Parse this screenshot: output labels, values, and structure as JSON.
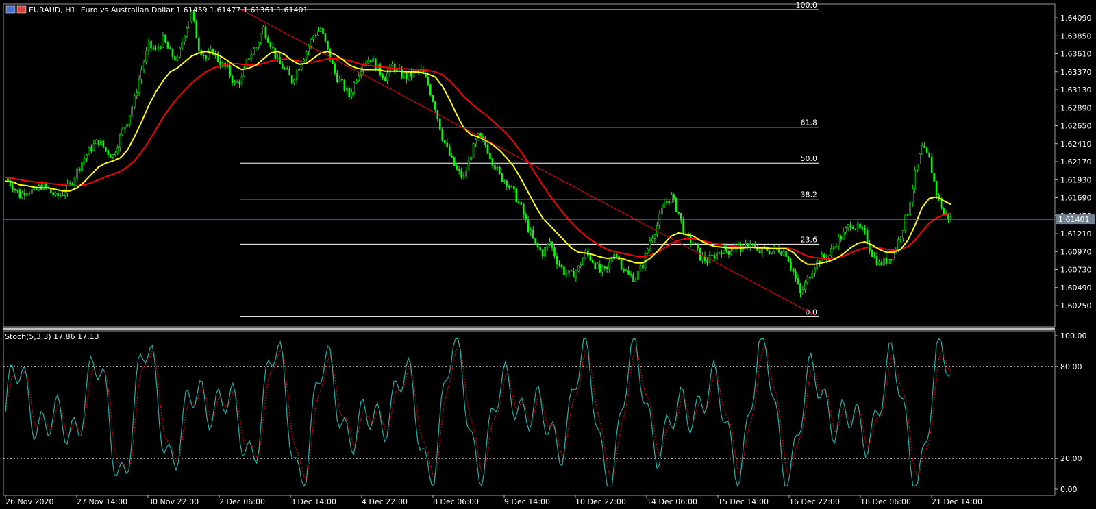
{
  "main_chart": {
    "symbol": "EURAUD",
    "timeframe": "H1",
    "description": "Euro vs Australian Dollar",
    "ohlc": "1.61459 1.61477 1.61361 1.61401",
    "title": "EURAUD, H1:  Euro vs Australian Dollar  1.61459 1.61477 1.61361 1.61401",
    "price_ticks": [
      "1.64090",
      "1.63850",
      "1.63610",
      "1.63370",
      "1.63130",
      "1.62890",
      "1.62650",
      "1.62410",
      "1.62170",
      "1.61930",
      "1.61690",
      "1.61450",
      "1.61210",
      "1.60970",
      "1.60730",
      "1.60490",
      "1.60250"
    ],
    "current_price": "1.61401",
    "fib_levels": [
      {
        "label": "100.0",
        "value": 1.642
      },
      {
        "label": "61.8",
        "value": 1.6263
      },
      {
        "label": "50.0",
        "value": 1.6215
      },
      {
        "label": "38.2",
        "value": 1.6167
      },
      {
        "label": "23.6",
        "value": 1.6107
      },
      {
        "label": "0.0",
        "value": 1.601
      }
    ]
  },
  "stoch_panel": {
    "title": "Stoch(5,3,3) 17.86 17.13",
    "ticks": [
      "100.00",
      "80.00",
      "20.00",
      "0.00"
    ]
  },
  "time_axis": {
    "labels": [
      "26 Nov 2020",
      "27 Nov 14:00",
      "30 Nov 22:00",
      "2 Dec 06:00",
      "3 Dec 14:00",
      "4 Dec 22:00",
      "8 Dec 06:00",
      "9 Dec 14:00",
      "10 Dec 22:00",
      "14 Dec 06:00",
      "15 Dec 14:00",
      "16 Dec 22:00",
      "18 Dec 06:00",
      "21 Dec 14:00"
    ]
  },
  "colors": {
    "background": "#000000",
    "candles": "#00ff00",
    "ma_fast": "#ffff00",
    "ma_slow": "#ff0000",
    "trendline": "#ff0000",
    "fib": "#ffffff",
    "stoch_main": "#20b2aa",
    "stoch_signal": "#ff0000",
    "price_line": "#708090"
  },
  "chart_data": {
    "type": "line",
    "title": "EURAUD, H1:  Euro vs Australian Dollar  1.61459 1.61477 1.61361 1.61401",
    "ylim": [
      1.601,
      1.643
    ],
    "series": [
      {
        "values": [
          1.6195,
          1.6185,
          1.6172,
          1.618,
          1.6176,
          1.6185,
          1.618,
          1.617,
          1.6175,
          1.6185,
          1.6205,
          1.6222,
          1.6236,
          1.6245,
          1.6232,
          1.6225,
          1.625,
          1.6272,
          1.63,
          1.634,
          1.6372,
          1.6365,
          1.638,
          1.6362,
          1.6352,
          1.639,
          1.6415,
          1.637,
          1.6355,
          1.6365,
          1.6348,
          1.634,
          1.632,
          1.6328,
          1.6358,
          1.637,
          1.6395,
          1.6375,
          1.635,
          1.634,
          1.6325,
          1.6345,
          1.6365,
          1.6385,
          1.6395,
          1.6365,
          1.6335,
          1.632,
          1.6305,
          1.633,
          1.635,
          1.6355,
          1.634,
          1.633,
          1.6345,
          1.6335,
          1.633,
          1.6335,
          1.6338,
          1.632,
          1.629,
          1.625,
          1.6225,
          1.6205,
          1.6195,
          1.6228,
          1.625,
          1.624,
          1.6218,
          1.6198,
          1.619,
          1.6175,
          1.6155,
          1.6128,
          1.6105,
          1.6095,
          1.611,
          1.6085,
          1.607,
          1.6065,
          1.6075,
          1.6095,
          1.6085,
          1.607,
          1.6072,
          1.6098,
          1.608,
          1.6065,
          1.6062,
          1.608,
          1.6112,
          1.6132,
          1.6162,
          1.617,
          1.6148,
          1.6115,
          1.611,
          1.609,
          1.6085,
          1.6092,
          1.61,
          1.6098,
          1.6105,
          1.61,
          1.611,
          1.6095,
          1.61,
          1.6098,
          1.61,
          1.6095,
          1.607,
          1.604,
          1.606,
          1.608,
          1.6088,
          1.6092,
          1.611,
          1.612,
          1.6135,
          1.6128,
          1.612,
          1.6095,
          1.608,
          1.6085,
          1.6095,
          1.612,
          1.615,
          1.62,
          1.6235,
          1.622,
          1.6175,
          1.6148,
          1.6141
        ]
      },
      {
        "values": [
          1.6191,
          1.619,
          1.6186,
          1.6185,
          1.6183,
          1.6182,
          1.6182,
          1.618,
          1.6178,
          1.6178,
          1.6182,
          1.619,
          1.62,
          1.621,
          1.6215,
          1.6218,
          1.6222,
          1.6232,
          1.625,
          1.627,
          1.6292,
          1.631,
          1.6325,
          1.6337,
          1.6342,
          1.635,
          1.6358,
          1.6362,
          1.6364,
          1.6362,
          1.6358,
          1.6352,
          1.6345,
          1.634,
          1.6342,
          1.6346,
          1.6354,
          1.6362,
          1.6364,
          1.636,
          1.6352,
          1.6347,
          1.6348,
          1.6355,
          1.6362,
          1.6364,
          1.636,
          1.6354,
          1.6346,
          1.6342,
          1.634,
          1.634,
          1.634,
          1.6338,
          1.6338,
          1.6338,
          1.6337,
          1.6337,
          1.6336,
          1.6334,
          1.633,
          1.6318,
          1.63,
          1.628,
          1.6262,
          1.6253,
          1.625,
          1.6246,
          1.624,
          1.6232,
          1.6222,
          1.621,
          1.6194,
          1.6176,
          1.6158,
          1.6142,
          1.6132,
          1.6122,
          1.6112,
          1.6102,
          1.6096,
          1.6095,
          1.6093,
          1.609,
          1.6088,
          1.6089,
          1.6088,
          1.6085,
          1.6082,
          1.6082,
          1.6088,
          1.6097,
          1.6108,
          1.6118,
          1.6122,
          1.612,
          1.6118,
          1.6112,
          1.6107,
          1.6104,
          1.6103,
          1.6102,
          1.6102,
          1.6102,
          1.6103,
          1.6102,
          1.6102,
          1.6101,
          1.6101,
          1.6101,
          1.6096,
          1.6086,
          1.608,
          1.608,
          1.6082,
          1.6084,
          1.6088,
          1.6094,
          1.6102,
          1.6108,
          1.611,
          1.6106,
          1.61,
          1.6096,
          1.6096,
          1.61,
          1.6112,
          1.6132,
          1.6156,
          1.6168,
          1.617,
          1.6165,
          1.616
        ]
      },
      {
        "values": [
          1.6196,
          1.6195,
          1.6193,
          1.6191,
          1.619,
          1.6189,
          1.6188,
          1.6187,
          1.6186,
          1.6185,
          1.6185,
          1.6186,
          1.6189,
          1.6193,
          1.6197,
          1.62,
          1.6204,
          1.621,
          1.6218,
          1.623,
          1.6244,
          1.626,
          1.6276,
          1.629,
          1.6302,
          1.6312,
          1.6322,
          1.633,
          1.6337,
          1.6342,
          1.6345,
          1.6347,
          1.6348,
          1.6347,
          1.6346,
          1.6346,
          1.6348,
          1.6351,
          1.6353,
          1.6354,
          1.6353,
          1.6351,
          1.635,
          1.635,
          1.6352,
          1.6354,
          1.6355,
          1.6354,
          1.6352,
          1.6349,
          1.6346,
          1.6345,
          1.6344,
          1.6343,
          1.6342,
          1.6341,
          1.6341,
          1.634,
          1.634,
          1.6339,
          1.6337,
          1.6333,
          1.6325,
          1.6315,
          1.6304,
          1.6295,
          1.6287,
          1.628,
          1.6272,
          1.6263,
          1.6254,
          1.6243,
          1.623,
          1.6216,
          1.6201,
          1.6186,
          1.6172,
          1.6159,
          1.6147,
          1.6136,
          1.6126,
          1.6118,
          1.6111,
          1.6105,
          1.61,
          1.6097,
          1.6095,
          1.6093,
          1.6091,
          1.609,
          1.6092,
          1.6096,
          1.6102,
          1.6108,
          1.6112,
          1.6114,
          1.6114,
          1.6112,
          1.611,
          1.6108,
          1.6106,
          1.6105,
          1.6104,
          1.6103,
          1.6103,
          1.6103,
          1.6103,
          1.6102,
          1.6102,
          1.6102,
          1.61,
          1.6095,
          1.6091,
          1.6089,
          1.6088,
          1.6088,
          1.6089,
          1.6091,
          1.6095,
          1.6099,
          1.6102,
          1.6103,
          1.6102,
          1.61,
          1.6099,
          1.61,
          1.6104,
          1.6112,
          1.6124,
          1.6135,
          1.6142,
          1.6146,
          1.6148
        ]
      }
    ]
  }
}
